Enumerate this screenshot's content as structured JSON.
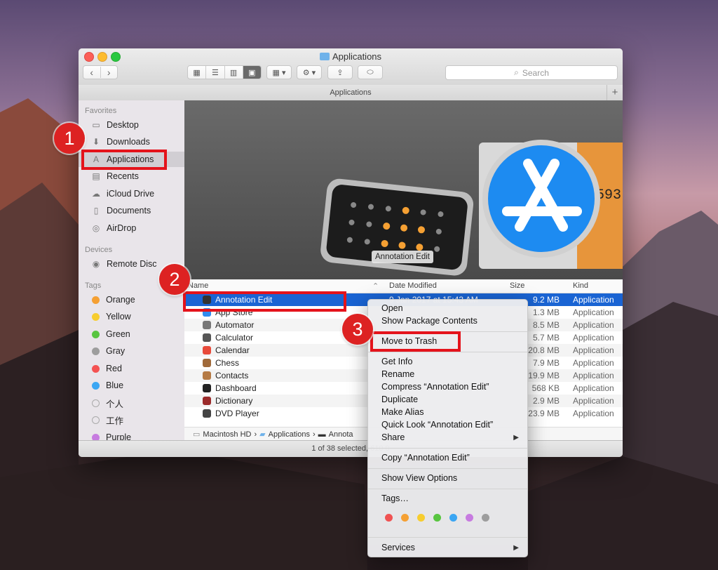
{
  "window": {
    "title": "Applications",
    "path_title": "Applications",
    "status": "1 of 38 selected, 610.0"
  },
  "toolbar": {
    "back": "‹",
    "forward": "›",
    "search_placeholder": "Search"
  },
  "sidebar": {
    "favorites_header": "Favorites",
    "favorites": [
      {
        "label": "Desktop",
        "icon": "desktop-icon"
      },
      {
        "label": "Downloads",
        "icon": "downloads-icon"
      },
      {
        "label": "Applications",
        "icon": "applications-icon"
      },
      {
        "label": "Recents",
        "icon": "recents-icon"
      },
      {
        "label": "iCloud Drive",
        "icon": "icloud-icon"
      },
      {
        "label": "Documents",
        "icon": "documents-icon"
      },
      {
        "label": "AirDrop",
        "icon": "airdrop-icon"
      }
    ],
    "devices_header": "Devices",
    "devices": [
      {
        "label": "Remote Disc",
        "icon": "disc-icon"
      }
    ],
    "tags_header": "Tags",
    "tags": [
      {
        "label": "Orange",
        "color": "#f5a033"
      },
      {
        "label": "Yellow",
        "color": "#f7cd2f"
      },
      {
        "label": "Green",
        "color": "#58c540"
      },
      {
        "label": "Gray",
        "color": "#9d9d9d"
      },
      {
        "label": "Red",
        "color": "#f45252"
      },
      {
        "label": "Blue",
        "color": "#3ba6f3"
      },
      {
        "label": "个人",
        "color": ""
      },
      {
        "label": "工作",
        "color": ""
      },
      {
        "label": "Purple",
        "color": "#c77be0"
      }
    ]
  },
  "preview": {
    "caption": "Annotation Edit",
    "counter": "1593"
  },
  "columns": {
    "name": "Name",
    "date": "Date Modified",
    "size": "Size",
    "kind": "Kind"
  },
  "files": [
    {
      "name": "Annotation Edit",
      "date": "9 Jan 2017 at 15:43 AM",
      "size": "9.2 MB",
      "kind": "Application",
      "color": "#333"
    },
    {
      "name": "App Store",
      "size": "1.3 MB",
      "kind": "Application",
      "color": "#2f8cf0"
    },
    {
      "name": "Automator",
      "size": "8.5 MB",
      "kind": "Application",
      "color": "#777"
    },
    {
      "name": "Calculator",
      "size": "5.7 MB",
      "kind": "Application",
      "color": "#555"
    },
    {
      "name": "Calendar",
      "size": "20.8 MB",
      "kind": "Application",
      "color": "#e84a3a"
    },
    {
      "name": "Chess",
      "size": "7.9 MB",
      "kind": "Application",
      "color": "#a06a3a"
    },
    {
      "name": "Contacts",
      "size": "19.9 MB",
      "kind": "Application",
      "color": "#b57a45"
    },
    {
      "name": "Dashboard",
      "size": "568 KB",
      "kind": "Application",
      "color": "#222"
    },
    {
      "name": "Dictionary",
      "size": "2.9 MB",
      "kind": "Application",
      "color": "#9b2b2b"
    },
    {
      "name": "DVD Player",
      "size": "23.9 MB",
      "kind": "Application",
      "color": "#444"
    }
  ],
  "breadcrumbs": {
    "hd": "Macintosh HD",
    "sep": "›",
    "apps": "Applications",
    "app": "Annota"
  },
  "menu": {
    "open": "Open",
    "show_package": "Show Package Contents",
    "move_trash": "Move to Trash",
    "get_info": "Get Info",
    "rename": "Rename",
    "compress": "Compress “Annotation Edit”",
    "duplicate": "Duplicate",
    "make_alias": "Make Alias",
    "quick_look": "Quick Look “Annotation Edit”",
    "share": "Share",
    "copy": "Copy “Annotation Edit”",
    "view_options": "Show View Options",
    "tags": "Tags…",
    "services": "Services",
    "tag_colors": [
      "#f05252",
      "#f5a033",
      "#f7cd2f",
      "#58c540",
      "#3ba6f3",
      "#c77be0",
      "#9d9d9d"
    ]
  },
  "badges": {
    "one": "1",
    "two": "2",
    "three": "3"
  }
}
